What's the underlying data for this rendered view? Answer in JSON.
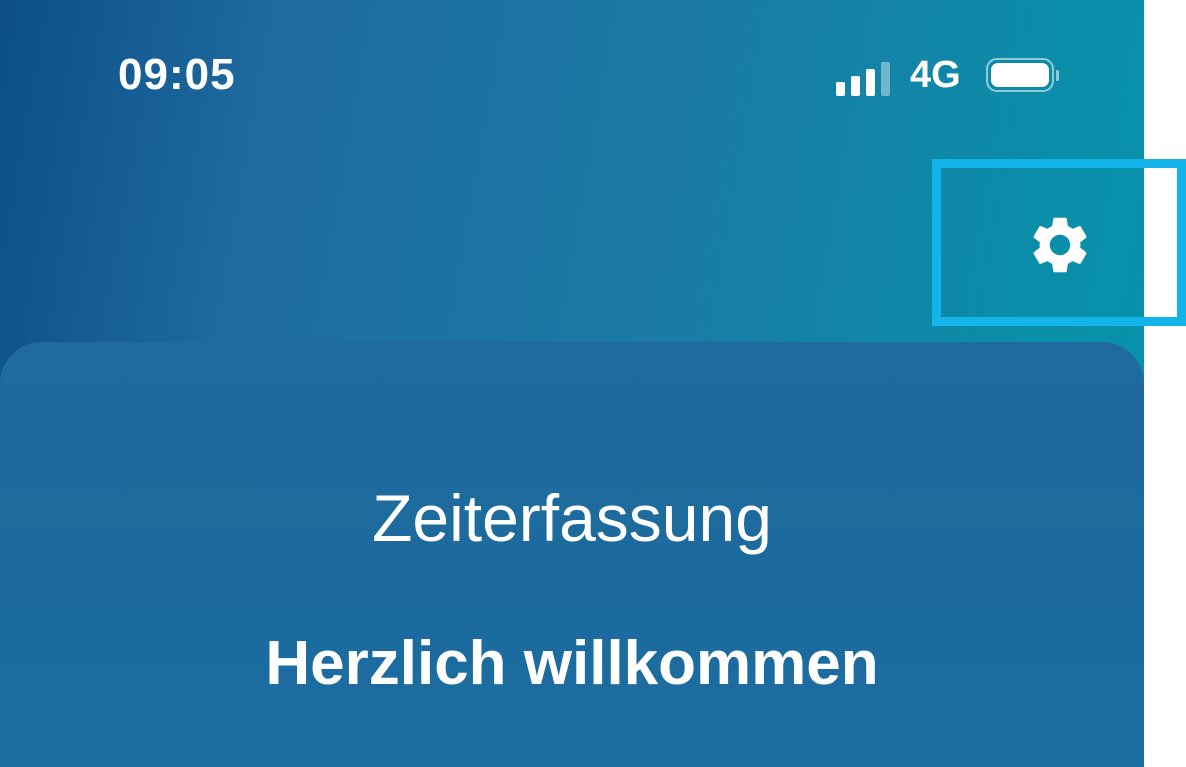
{
  "status_bar": {
    "time": "09:05",
    "network": "4G",
    "signal_icon": "signal-strength-icon",
    "battery_icon": "battery-icon"
  },
  "header": {
    "settings_icon": "gear-icon"
  },
  "card": {
    "title": "Zeiterfassung",
    "subtitle": "Herzlich willkommen"
  },
  "colors": {
    "gradient_start": "#0b4f86",
    "gradient_end": "#0793ab",
    "card_background": "#1f6a9e",
    "highlight": "#12b4ea",
    "text": "#ffffff"
  }
}
